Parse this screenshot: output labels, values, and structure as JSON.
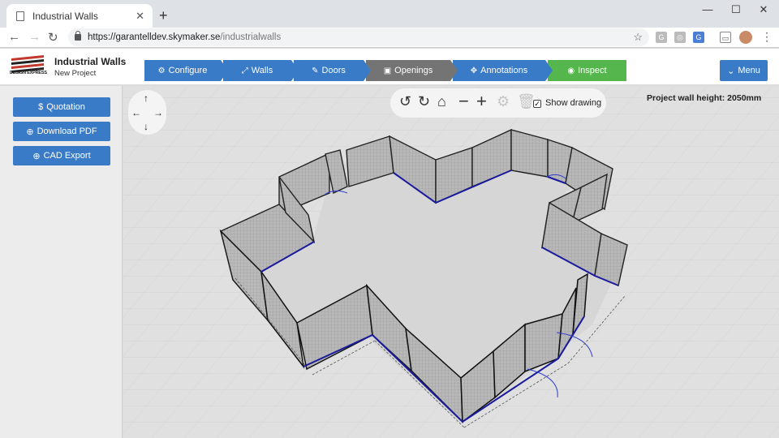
{
  "browser": {
    "tab_title": "Industrial Walls",
    "url_host": "https://garantelldev.skymaker.se",
    "url_path": "/industrialwalls"
  },
  "app": {
    "logo_text": "DESIGN EXPRESS",
    "title": "Industrial Walls",
    "subtitle": "New Project"
  },
  "steps": [
    {
      "label": "Configure",
      "icon": "gear-icon",
      "color": "#3a7bc8"
    },
    {
      "label": "Walls",
      "icon": "resize-icon",
      "color": "#3a7bc8"
    },
    {
      "label": "Doors",
      "icon": "edit-icon",
      "color": "#3a7bc8"
    },
    {
      "label": "Openings",
      "icon": "window-icon",
      "color": "#747474"
    },
    {
      "label": "Annotations",
      "icon": "crosshair-icon",
      "color": "#3a7bc8"
    },
    {
      "label": "Inspect",
      "icon": "eye-icon",
      "color": "#54b64c"
    }
  ],
  "menu_label": "Menu",
  "sidebar": {
    "quotation": "Quotation",
    "download_pdf": "Download PDF",
    "cad_export": "CAD Export"
  },
  "toolbar": {
    "show_drawing": "Show drawing",
    "show_drawing_checked": true
  },
  "wall_height": "Project wall height: 2050mm"
}
